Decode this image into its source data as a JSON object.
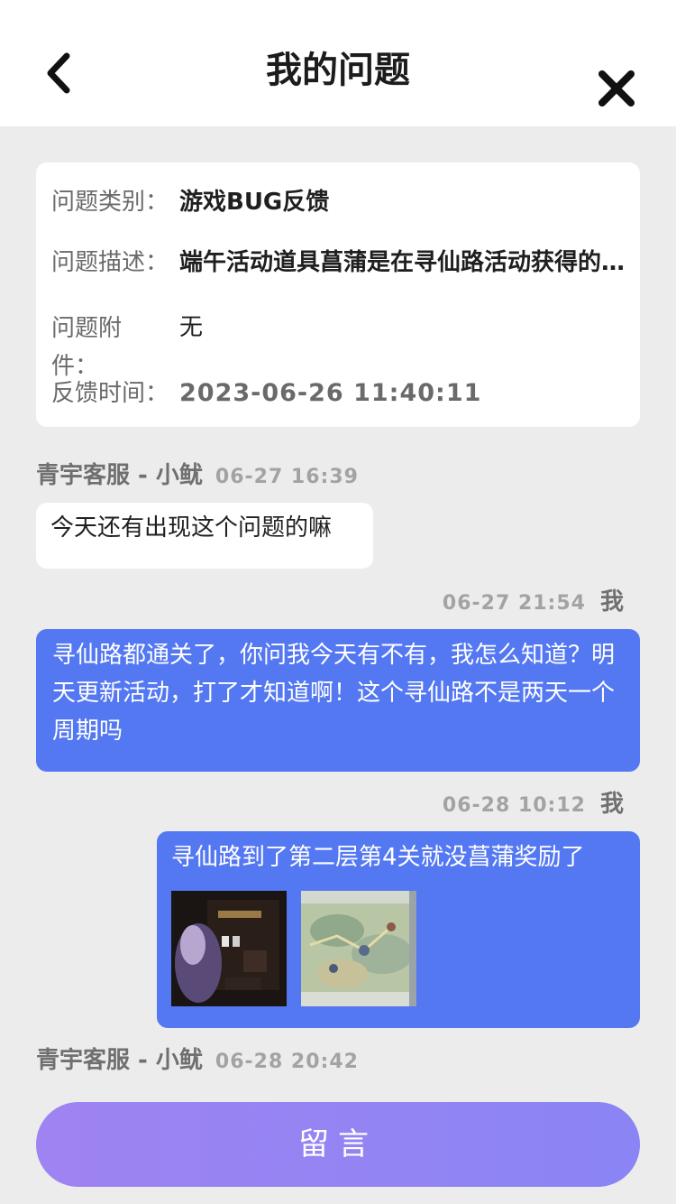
{
  "header": {
    "title": "我的问题"
  },
  "issue": {
    "category_label": "问题类别：",
    "category_value": "游戏BUG反馈",
    "description_label": "问题描述：",
    "description_value": "端午活动道具菖蒲是在寻仙路活动获得的吗？",
    "attachment_label": "问题附件：",
    "attachment_value": "无",
    "time_label": "反馈时间：",
    "time_value": "2023-06-26 11:40:11"
  },
  "messages": [
    {
      "sender": "青宇客服 - 小鱿",
      "time": "06-27 16:39",
      "text": "今天还有出现这个问题的嘛"
    },
    {
      "sender": "我",
      "time": "06-27 21:54",
      "text": "寻仙路都通关了，你问我今天有不有，我怎么知道？明天更新活动，打了才知道啊！这个寻仙路不是两天一个周期吗"
    },
    {
      "sender": "我",
      "time": "06-28 10:12",
      "text": "寻仙路到了第二层第4关就没菖蒲奖励了"
    },
    {
      "sender": "青宇客服 - 小鱿",
      "time": "06-28 20:42"
    }
  ],
  "footer": {
    "button_label": "留言"
  },
  "colors": {
    "accent_blue": "#5478f2",
    "button_gradient_start": "#9f83f2",
    "button_gradient_end": "#8a84f4"
  },
  "icons": {
    "back": "chevron-left-icon",
    "close": "close-icon"
  }
}
